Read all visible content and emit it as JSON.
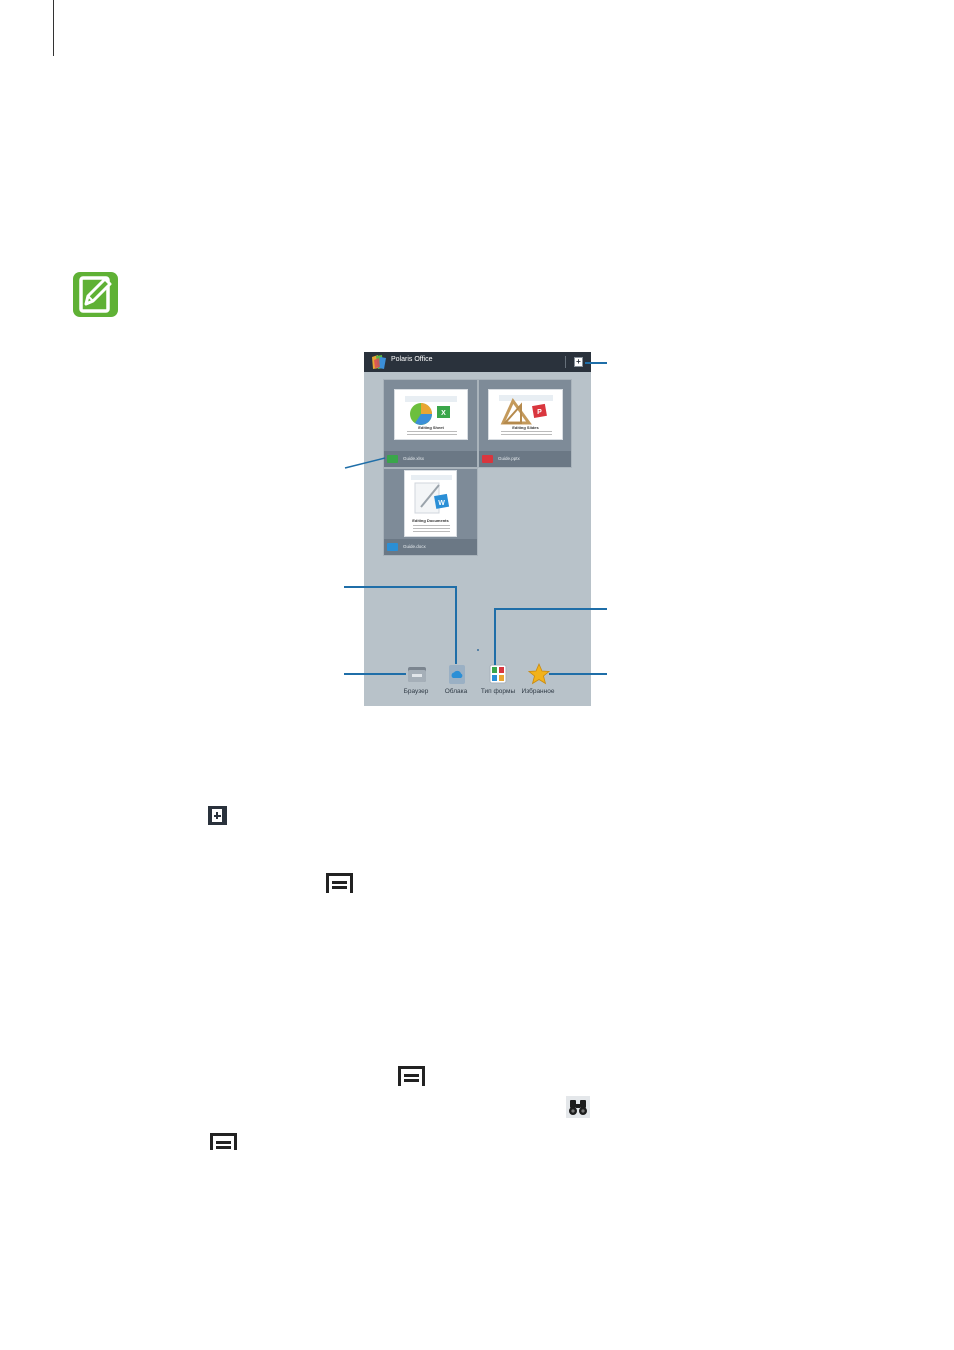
{
  "app": {
    "title": "Polaris Office"
  },
  "documents": [
    {
      "thumb_caption": "Editing Sheet",
      "file_name": "Guide.xlsx",
      "color": "#3aa64a"
    },
    {
      "thumb_caption": "Editing Slides",
      "file_name": "Guide.pptx",
      "color": "#d9363e"
    },
    {
      "thumb_caption": "Editing Documents",
      "file_name": "Guide.docx",
      "color": "#2b8fd6"
    }
  ],
  "dock": {
    "browser_label": "Браузер",
    "cloud_label": "Облака",
    "form_type_label": "Тип формы",
    "favorites_label": "Избранное"
  },
  "colors": {
    "note_green": "#5fb135",
    "callout_blue": "#1f6ea8",
    "titlebar": "#2a323c",
    "screen_bg": "#b8c2c9"
  }
}
